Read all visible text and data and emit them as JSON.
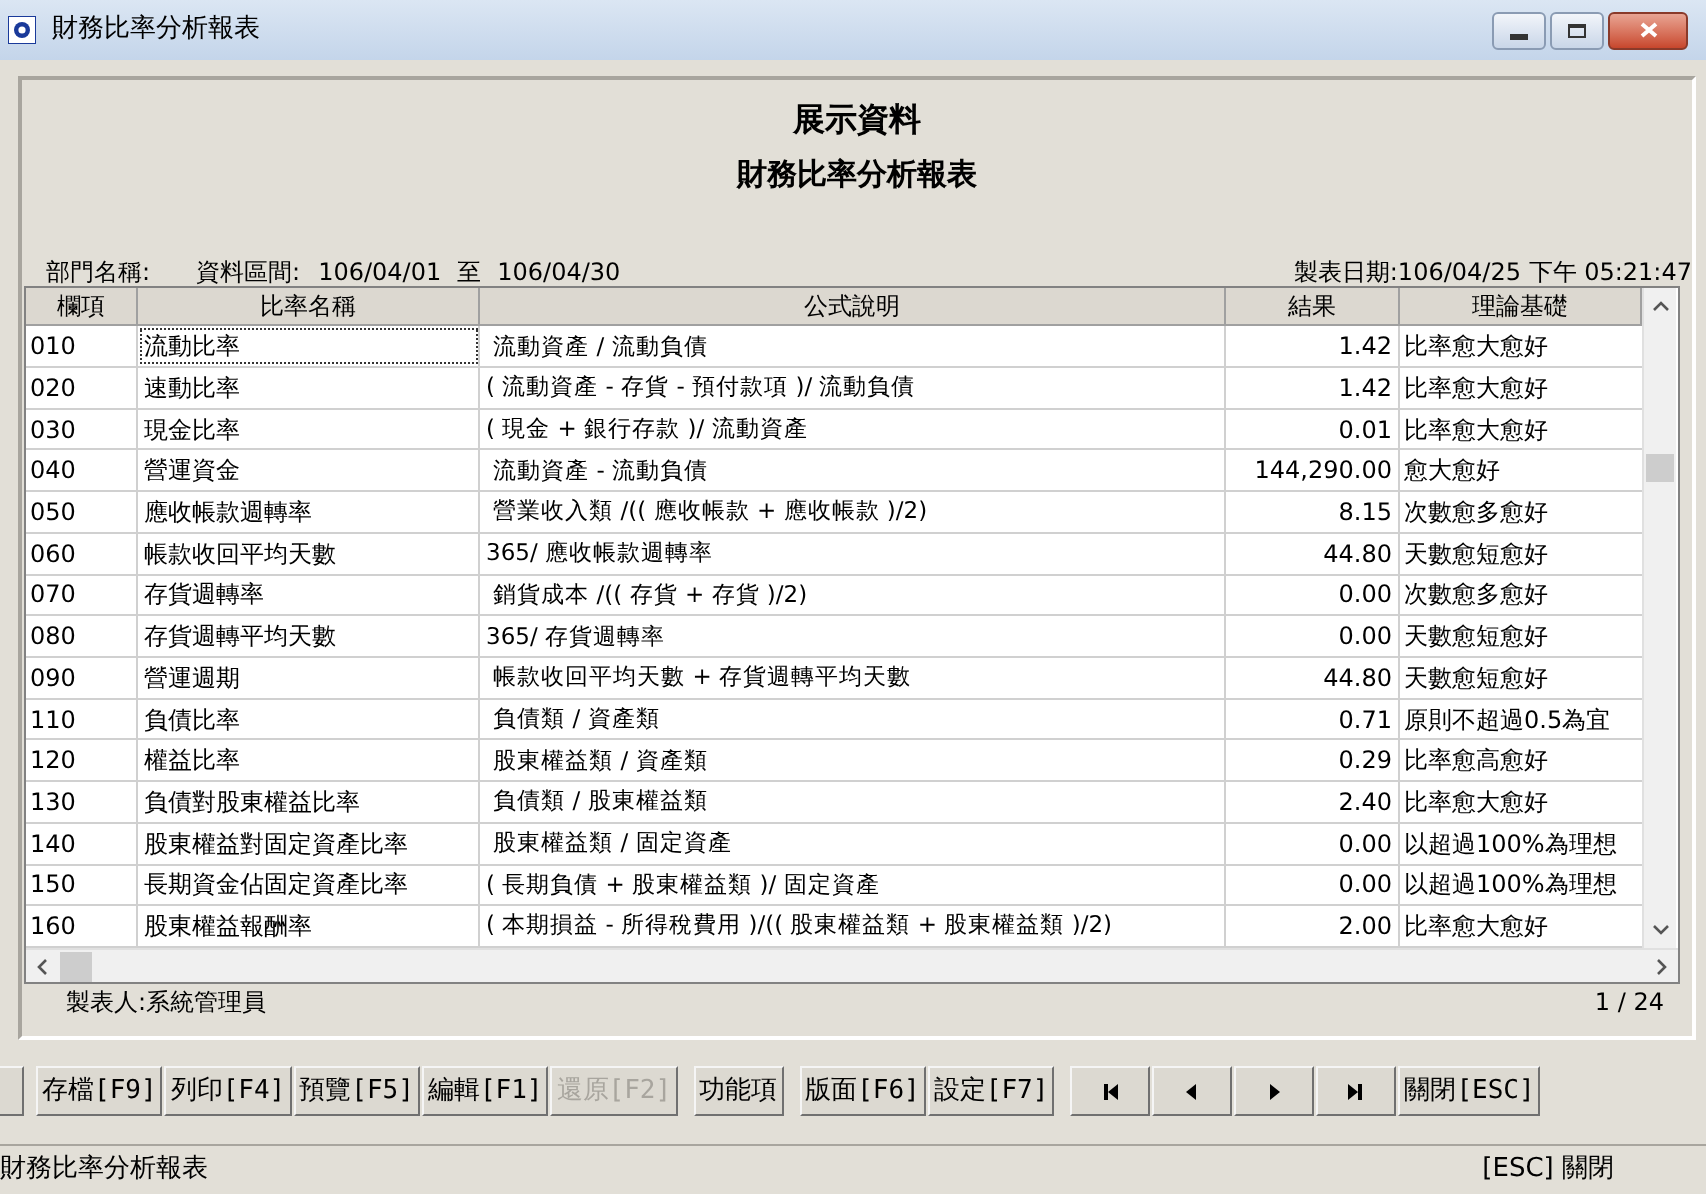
{
  "window": {
    "title": "財務比率分析報表"
  },
  "report": {
    "title": "展示資料",
    "subtitle": "財務比率分析報表",
    "department_label": "部門名稱:",
    "period_label": "資料區間:",
    "period_start": "106/04/01",
    "period_to": "至",
    "period_end": "106/04/30",
    "print_date": "製表日期:106/04/25 下午 05:21:47"
  },
  "table": {
    "columns": [
      "欄項",
      "比率名稱",
      "公式說明",
      "結果",
      "理論基礎"
    ],
    "rows": [
      {
        "code": "010",
        "name": "流動比率",
        "formula": " 流動資產 / 流動負債",
        "result": "1.42",
        "basis": "比率愈大愈好",
        "focused": true
      },
      {
        "code": "020",
        "name": "速動比率",
        "formula": "( 流動資產 - 存貨 - 預付款項 )/ 流動負債",
        "result": "1.42",
        "basis": "比率愈大愈好",
        "focused": false
      },
      {
        "code": "030",
        "name": "現金比率",
        "formula": "( 現金 + 銀行存款 )/ 流動資產",
        "result": "0.01",
        "basis": "比率愈大愈好",
        "focused": false
      },
      {
        "code": "040",
        "name": "營運資金",
        "formula": " 流動資產 - 流動負債",
        "result": "144,290.00",
        "basis": "愈大愈好",
        "focused": false
      },
      {
        "code": "050",
        "name": "應收帳款週轉率",
        "formula": " 營業收入類 /(( 應收帳款 + 應收帳款 )/2)",
        "result": "8.15",
        "basis": "次數愈多愈好",
        "focused": false
      },
      {
        "code": "060",
        "name": "帳款收回平均天數",
        "formula": "365/ 應收帳款週轉率",
        "result": "44.80",
        "basis": "天數愈短愈好",
        "focused": false
      },
      {
        "code": "070",
        "name": "存貨週轉率",
        "formula": " 銷貨成本 /(( 存貨 + 存貨 )/2)",
        "result": "0.00",
        "basis": "次數愈多愈好",
        "focused": false
      },
      {
        "code": "080",
        "name": "存貨週轉平均天數",
        "formula": "365/ 存貨週轉率",
        "result": "0.00",
        "basis": "天數愈短愈好",
        "focused": false
      },
      {
        "code": "090",
        "name": "營運週期",
        "formula": " 帳款收回平均天數 + 存貨週轉平均天數",
        "result": "44.80",
        "basis": "天數愈短愈好",
        "focused": false
      },
      {
        "code": "110",
        "name": "負債比率",
        "formula": " 負債類 / 資產類",
        "result": "0.71",
        "basis": "原則不超過0.5為宜",
        "focused": false
      },
      {
        "code": "120",
        "name": "權益比率",
        "formula": " 股東權益類 / 資產類",
        "result": "0.29",
        "basis": "比率愈高愈好",
        "focused": false
      },
      {
        "code": "130",
        "name": "負債對股東權益比率",
        "formula": " 負債類 / 股東權益類",
        "result": "2.40",
        "basis": "比率愈大愈好",
        "focused": false
      },
      {
        "code": "140",
        "name": "股東權益對固定資產比率",
        "formula": " 股東權益類 / 固定資產",
        "result": "0.00",
        "basis": "以超過100%為理想",
        "focused": false
      },
      {
        "code": "150",
        "name": "長期資金佔固定資產比率",
        "formula": "( 長期負債 + 股東權益類 )/ 固定資產",
        "result": "0.00",
        "basis": "以超過100%為理想",
        "focused": false
      },
      {
        "code": "160",
        "name": "股東權益報酬率",
        "formula": "( 本期損益 - 所得稅費用 )/(( 股東權益類 + 股東權益類 )/2)",
        "result": "2.00",
        "basis": "比率愈大愈好",
        "focused": false
      }
    ]
  },
  "footer": {
    "maker": "製表人:系統管理員",
    "page": "1 / 24"
  },
  "buttons": [
    {
      "kind": "stub"
    },
    {
      "kind": "text",
      "label": "存檔[F9]",
      "disabled": false
    },
    {
      "kind": "text",
      "label": "列印[F4]",
      "disabled": false
    },
    {
      "kind": "text",
      "label": "預覽[F5]",
      "disabled": false
    },
    {
      "kind": "text",
      "label": "編輯[F1]",
      "disabled": false
    },
    {
      "kind": "text",
      "label": "還原[F2]",
      "disabled": true
    },
    {
      "kind": "gap"
    },
    {
      "kind": "text",
      "label": "功能項",
      "disabled": false
    },
    {
      "kind": "gap"
    },
    {
      "kind": "text",
      "label": "版面[F6]",
      "disabled": false
    },
    {
      "kind": "text",
      "label": "設定[F7]",
      "disabled": false
    },
    {
      "kind": "gap"
    },
    {
      "kind": "first"
    },
    {
      "kind": "prev"
    },
    {
      "kind": "next"
    },
    {
      "kind": "last"
    },
    {
      "kind": "text",
      "label": "關閉[ESC]",
      "disabled": false
    }
  ],
  "status_bar": {
    "left": "財務比率分析報表",
    "right": "[ESC] 關閉"
  }
}
